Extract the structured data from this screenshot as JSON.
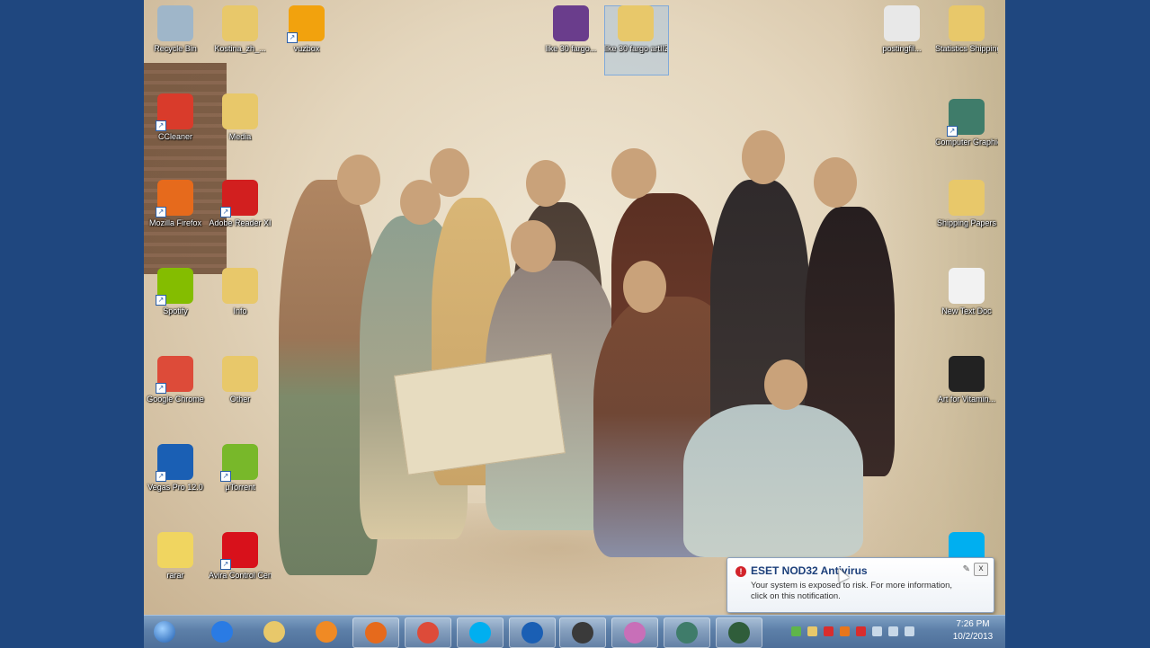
{
  "desktop": {
    "icons": [
      {
        "id": "recycle-bin",
        "label": "Recycle Bin",
        "icon": "recycle-bin-icon",
        "color": "#9fb6c9",
        "shortcut": false
      },
      {
        "id": "folder-1",
        "label": "Kostina_zh_...",
        "icon": "folder-icon",
        "color": "#e8c86a",
        "shortcut": false
      },
      {
        "id": "vuze",
        "label": "vuzbox",
        "icon": "vuze-icon",
        "color": "#f2a20d",
        "shortcut": true
      },
      {
        "id": "winrar",
        "label": "like 30 fargo...",
        "icon": "winrar-archive-icon",
        "color": "#6a3d8c",
        "shortcut": false
      },
      {
        "id": "selected-file",
        "label": "like 30 fargo artIIZ",
        "icon": "folder-icon",
        "color": "#e8c86a",
        "shortcut": false
      },
      {
        "id": "pdf-doc",
        "label": "postingfil...",
        "icon": "pdf-document-icon",
        "color": "#e8e8e8",
        "shortcut": false
      },
      {
        "id": "folder-right-1",
        "label": "Statistics Shipping",
        "icon": "folder-icon",
        "color": "#e8c86a",
        "shortcut": false
      },
      {
        "id": "ccleaner",
        "label": "CCleaner",
        "icon": "ccleaner-icon",
        "color": "#d93b2b",
        "shortcut": true
      },
      {
        "id": "folder-2",
        "label": "Media",
        "icon": "folder-icon",
        "color": "#e8c86a",
        "shortcut": false
      },
      {
        "id": "computer-shortcut",
        "label": "Computer Graphics",
        "icon": "computer-icon",
        "color": "#3f7c6a",
        "shortcut": true
      },
      {
        "id": "firefox",
        "label": "Mozilla Firefox",
        "icon": "firefox-icon",
        "color": "#e66a1c",
        "shortcut": true
      },
      {
        "id": "adobe-reader",
        "label": "Adobe Reader XI",
        "icon": "adobe-reader-icon",
        "color": "#d21f1f",
        "shortcut": true
      },
      {
        "id": "folder-right-2",
        "label": "Shipping Papers",
        "icon": "folder-icon",
        "color": "#e8c86a",
        "shortcut": false
      },
      {
        "id": "spotify",
        "label": "Spotify",
        "icon": "spotify-icon",
        "color": "#84bd00",
        "shortcut": true
      },
      {
        "id": "folder-3",
        "label": "Info",
        "icon": "folder-icon",
        "color": "#e8c86a",
        "shortcut": false
      },
      {
        "id": "blank-doc",
        "label": "New Text Doc",
        "icon": "text-document-icon",
        "color": "#f2f2f2",
        "shortcut": false
      },
      {
        "id": "chrome",
        "label": "Google Chrome",
        "icon": "chrome-icon",
        "color": "#dd4b39",
        "shortcut": true
      },
      {
        "id": "folder-other",
        "label": "Other",
        "icon": "folder-icon",
        "color": "#e8c86a",
        "shortcut": false
      },
      {
        "id": "video-file",
        "label": "Art for Vitamin...",
        "icon": "video-file-icon",
        "color": "#222222",
        "shortcut": false
      },
      {
        "id": "vegas",
        "label": "Vegas Pro 12.0",
        "icon": "vegas-pro-icon",
        "color": "#1a5fb4",
        "shortcut": true
      },
      {
        "id": "utorrent",
        "label": "µTorrent",
        "icon": "utorrent-icon",
        "color": "#78b82a",
        "shortcut": true
      },
      {
        "id": "winrar-app",
        "label": "rarar",
        "icon": "winrar-icon",
        "color": "#f0d560",
        "shortcut": false
      },
      {
        "id": "avira",
        "label": "Avira Control Center",
        "icon": "avira-icon",
        "color": "#d8111b",
        "shortcut": true
      },
      {
        "id": "skype",
        "label": "Skype",
        "icon": "skype-icon",
        "color": "#00aff0",
        "shortcut": true
      }
    ]
  },
  "taskbar": {
    "start_icon": "windows-start-icon",
    "pinned": [
      {
        "id": "ie",
        "icon": "internet-explorer-icon",
        "color": "#2a7be4",
        "active": false
      },
      {
        "id": "explorer",
        "icon": "folder-icon",
        "color": "#e8c86a",
        "active": false
      },
      {
        "id": "media",
        "icon": "media-player-icon",
        "color": "#f08a24",
        "active": false
      },
      {
        "id": "firefox",
        "icon": "firefox-icon",
        "color": "#e66a1c",
        "active": true
      },
      {
        "id": "chrome",
        "icon": "chrome-icon",
        "color": "#dd4b39",
        "active": true
      },
      {
        "id": "skype",
        "icon": "skype-icon",
        "color": "#00aff0",
        "active": true
      },
      {
        "id": "vegas",
        "icon": "vegas-pro-icon",
        "color": "#1a5fb4",
        "active": true
      },
      {
        "id": "video",
        "icon": "video-app-icon",
        "color": "#3a3a3a",
        "active": true
      },
      {
        "id": "paint",
        "icon": "paint-icon",
        "color": "#c86fb8",
        "active": true
      },
      {
        "id": "ccleaner",
        "icon": "computer-icon",
        "color": "#3f7c6a",
        "active": true
      },
      {
        "id": "games",
        "icon": "game-icon",
        "color": "#2f5d3a",
        "active": true
      }
    ],
    "tray_colors": [
      "#5fb54a",
      "#e8c86a",
      "#d92d2d",
      "#e8761b",
      "#d92d2d",
      "#c8d8e8",
      "#c8d8e8",
      "#c8d8e8"
    ],
    "clock": {
      "time": "7:26 PM",
      "date": "10/2/2013"
    }
  },
  "notification": {
    "title": "ESET NOD32 Antivirus",
    "body": "Your system is exposed to risk. For more information, click on this notification.",
    "icon": "warning-icon",
    "close": "x",
    "settings_icon": "settings-icon"
  }
}
